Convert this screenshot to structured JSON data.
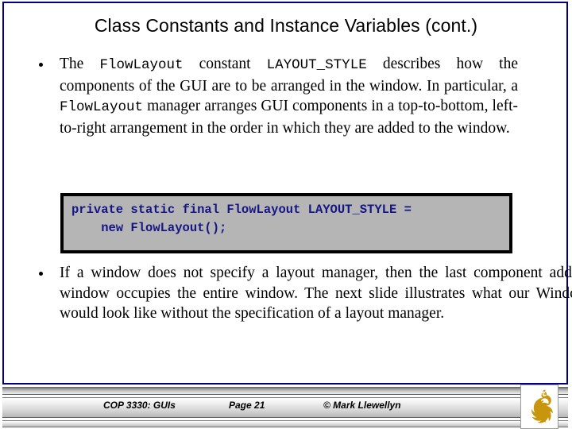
{
  "slide": {
    "title": "Class Constants and Instance Variables (cont.)",
    "border_color": "#000080",
    "background": "#ffffff"
  },
  "bullets": [
    {
      "marker": "bullet-dot",
      "segments": [
        {
          "type": "text",
          "value": "The "
        },
        {
          "type": "code",
          "value": "FlowLayout"
        },
        {
          "type": "text",
          "value": " constant "
        },
        {
          "type": "code",
          "value": "LAYOUT_STYLE"
        },
        {
          "type": "text",
          "value": " describes how the components of the GUI are to be arranged in the window.  In particular, a "
        },
        {
          "type": "code",
          "value": "FlowLayout"
        },
        {
          "type": "text",
          "value": " manager arranges GUI components in a top-to-bottom, left-to-right arrangement in the order in which they are added to the window."
        }
      ]
    },
    {
      "marker": "bullet-dot",
      "segments": [
        {
          "type": "text",
          "value": "If a window does not specify a layout manager, then the last component added to the window occupies the entire window.  The next slide illustrates what our Windchill GUI would look like without the specification of a layout manager."
        }
      ]
    }
  ],
  "code_box": {
    "background": "#b5b5b5",
    "border_color": "#000000",
    "text_color": "#151585",
    "lines": [
      "private static final FlowLayout LAYOUT_STYLE =",
      "    new FlowLayout();"
    ]
  },
  "footer": {
    "course": "COP 3330:  GUIs",
    "page": "Page 21",
    "copyright": "© Mark Llewellyn",
    "logo_name": "ucf-pegasus-logo",
    "logo_color": "#c8960c"
  }
}
